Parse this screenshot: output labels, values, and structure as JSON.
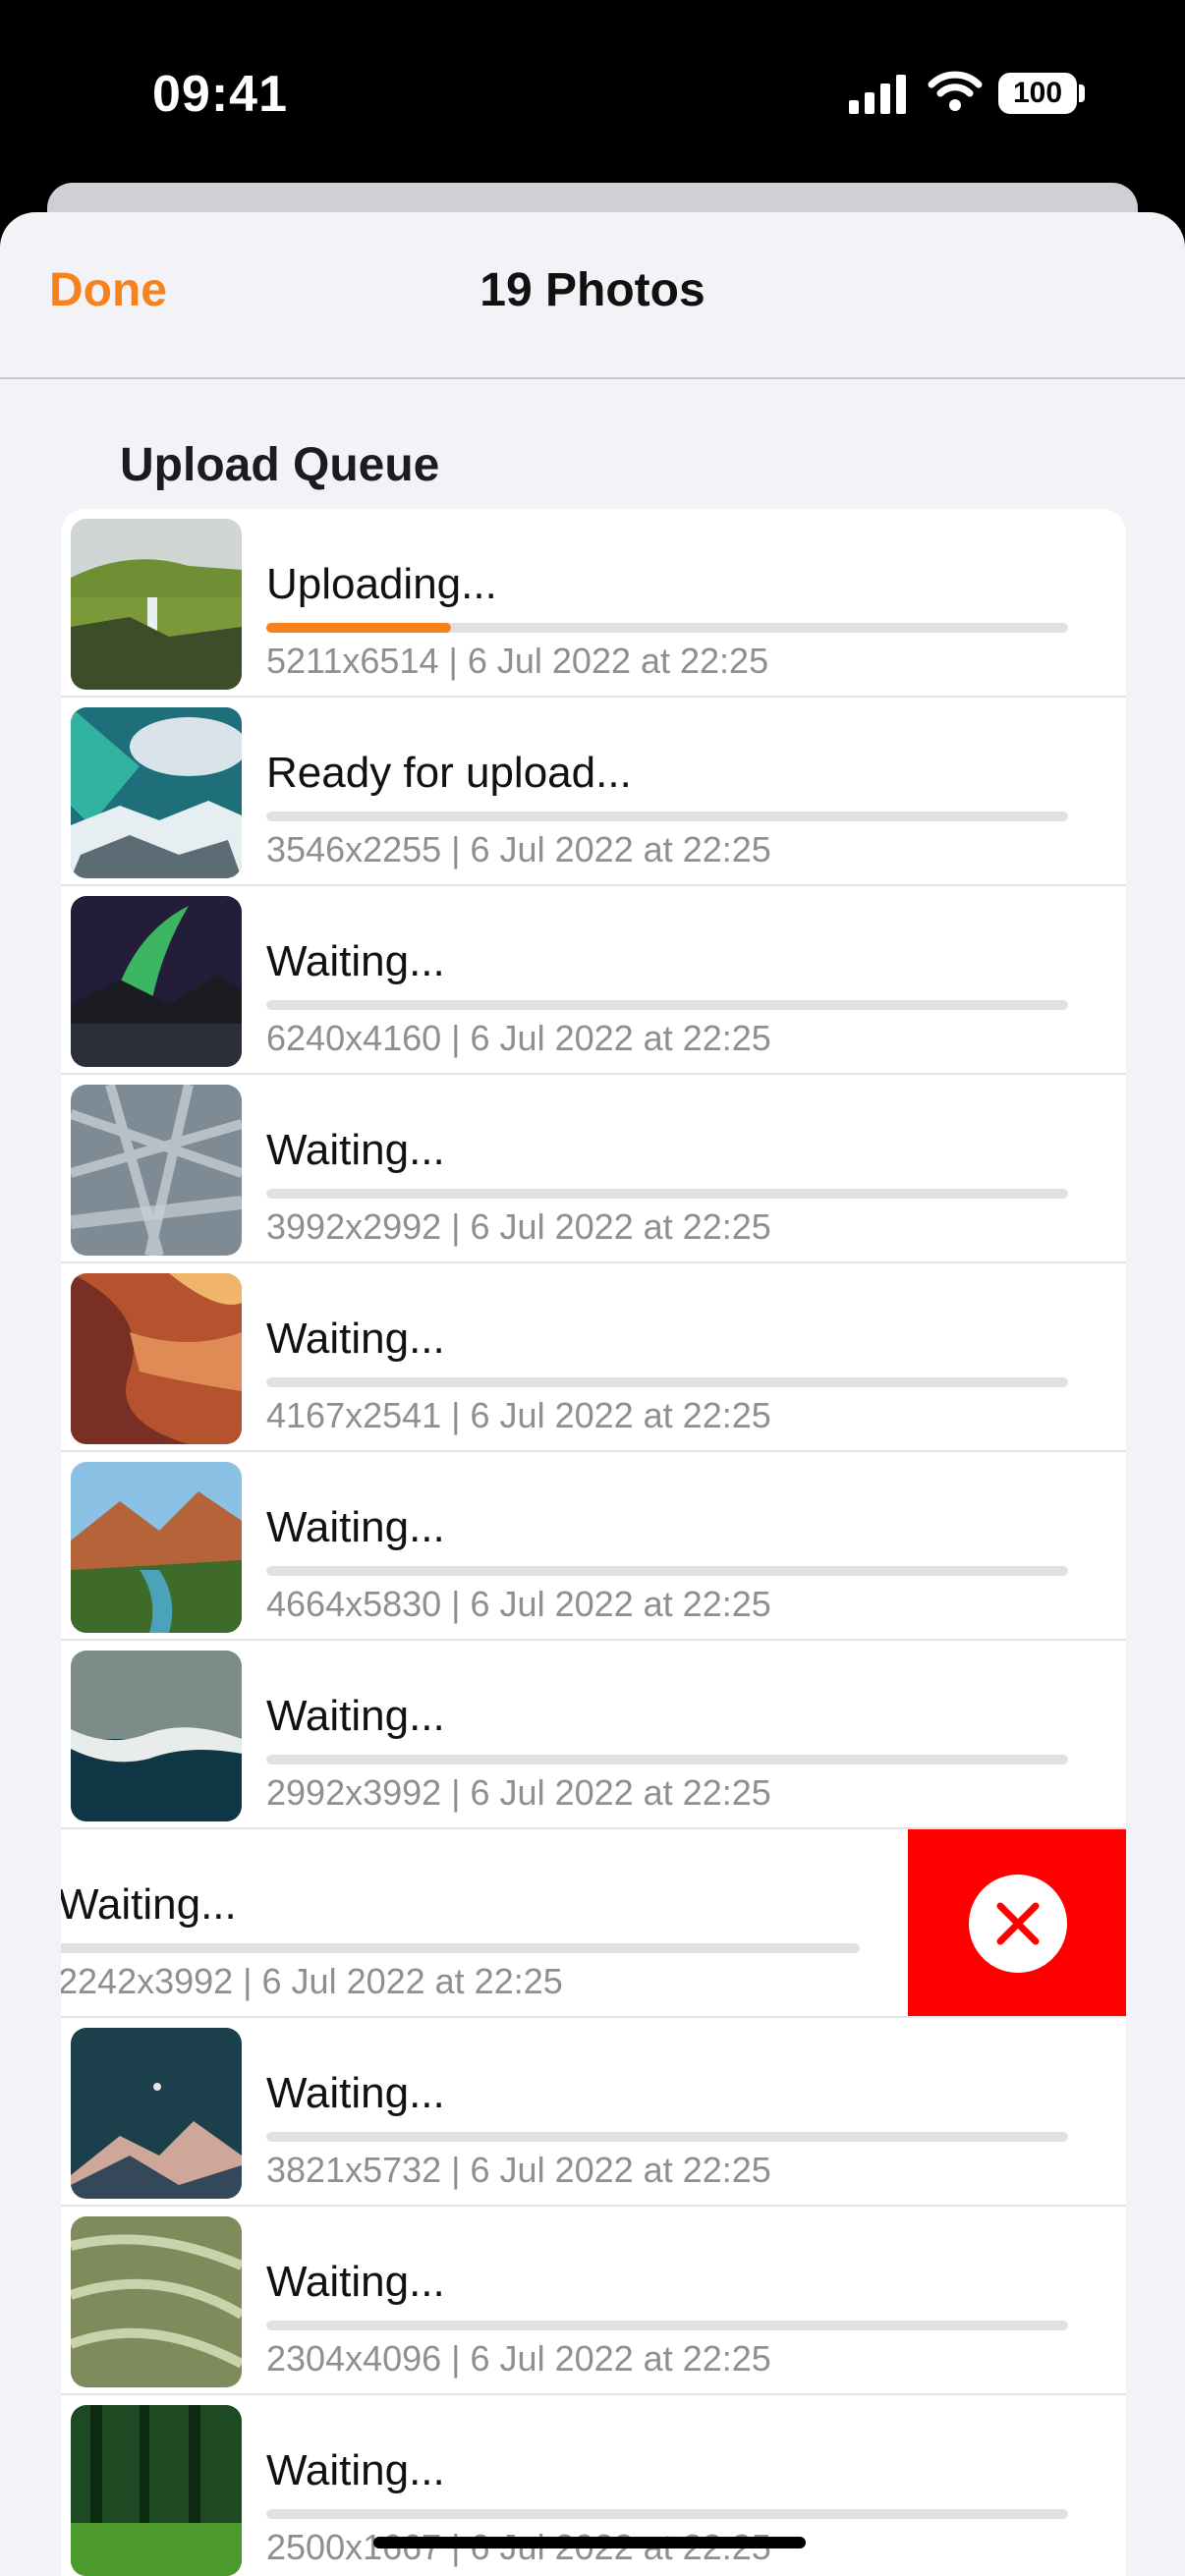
{
  "status_bar": {
    "time": "09:41",
    "battery": "100"
  },
  "nav": {
    "done_label": "Done",
    "title": "19 Photos"
  },
  "section": {
    "header": "Upload Queue"
  },
  "accent_color": "#f7821b",
  "delete_color": "#ff0000",
  "rows": [
    {
      "status": "Uploading...",
      "meta": "5211x6514 | 6 Jul 2022 at 22:25",
      "progress": 0.23
    },
    {
      "status": "Ready for upload...",
      "meta": "3546x2255 | 6 Jul 2022 at 22:25",
      "progress": 0
    },
    {
      "status": "Waiting...",
      "meta": "6240x4160 | 6 Jul 2022 at 22:25",
      "progress": 0
    },
    {
      "status": "Waiting...",
      "meta": "3992x2992 | 6 Jul 2022 at 22:25",
      "progress": 0
    },
    {
      "status": "Waiting...",
      "meta": "4167x2541 | 6 Jul 2022 at 22:25",
      "progress": 0
    },
    {
      "status": "Waiting...",
      "meta": "4664x5830 | 6 Jul 2022 at 22:25",
      "progress": 0
    },
    {
      "status": "Waiting...",
      "meta": "2992x3992 | 6 Jul 2022 at 22:25",
      "progress": 0
    },
    {
      "status": "Waiting...",
      "meta": "2242x3992 | 6 Jul 2022 at 22:25",
      "progress": 0
    },
    {
      "status": "Waiting...",
      "meta": "3821x5732 | 6 Jul 2022 at 22:25",
      "progress": 0
    },
    {
      "status": "Waiting...",
      "meta": "2304x4096 | 6 Jul 2022 at 22:25",
      "progress": 0
    },
    {
      "status": "Waiting...",
      "meta": "2500x1667 | 6 Jul 2022 at 22:25",
      "progress": 0
    }
  ]
}
